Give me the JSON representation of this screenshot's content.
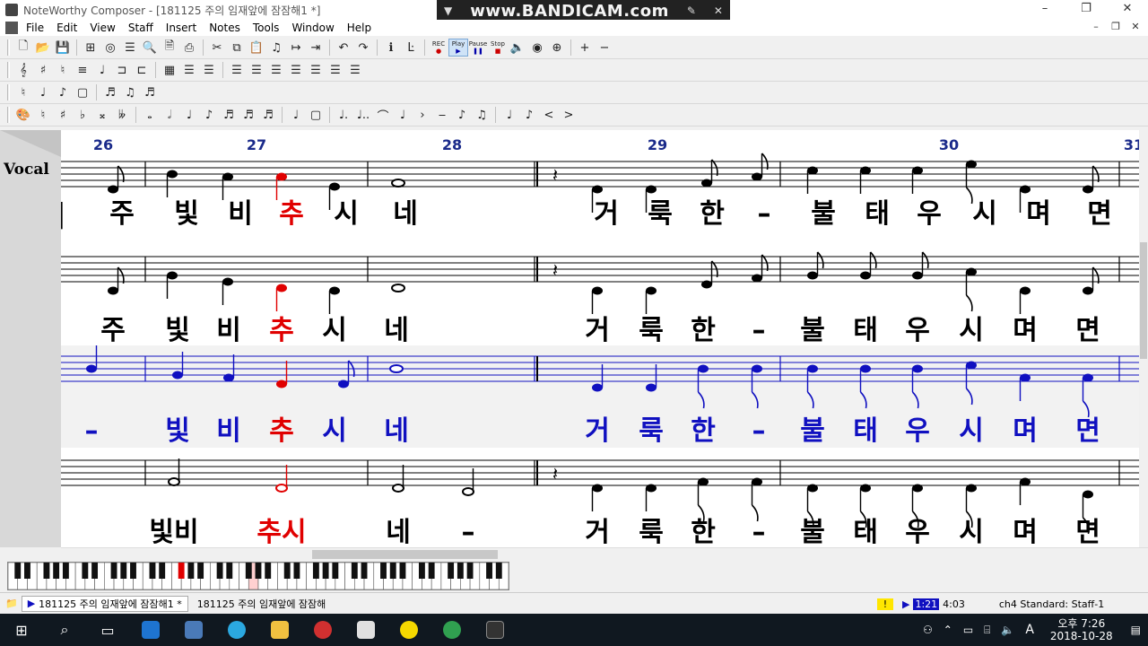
{
  "window": {
    "title": "NoteWorthy Composer - [181125 주의 임재앞에 잠잠해1 *]",
    "minimize": "–",
    "restore": "❐",
    "close": "✕"
  },
  "watermark": {
    "text": "www.BANDICAM.com"
  },
  "menu": {
    "items": [
      "File",
      "Edit",
      "View",
      "Staff",
      "Insert",
      "Notes",
      "Tools",
      "Window",
      "Help"
    ]
  },
  "toolbars": {
    "row1": [
      "new",
      "open",
      "save",
      "print",
      "cut",
      "copy",
      "paste",
      "undo",
      "redo",
      "rec",
      "play",
      "pause",
      "stop",
      "volume",
      "plus",
      "minus"
    ],
    "rec_label": "REC",
    "play_label": "Play",
    "pause_label": "Pause",
    "stop_label": "Stop"
  },
  "score": {
    "staff_name": "Vocal",
    "measure_numbers": [
      "26",
      "27",
      "28",
      "29",
      "30",
      "31"
    ],
    "lyrics": {
      "row1": [
        "|",
        "주",
        "빛",
        "비",
        "추",
        "시",
        "네",
        "거",
        "룩",
        "한",
        "–",
        "불",
        "태",
        "우",
        "시",
        "며",
        "면"
      ],
      "row2": [
        "주",
        "빛",
        "비",
        "추",
        "시",
        "네",
        "거",
        "룩",
        "한",
        "–",
        "불",
        "태",
        "우",
        "시",
        "며",
        "면"
      ],
      "row3": [
        "–",
        "빛",
        "비",
        "추",
        "시",
        "네",
        "거",
        "룩",
        "한",
        "–",
        "불",
        "태",
        "우",
        "시",
        "며",
        "면"
      ],
      "row4": [
        "빛비",
        "추시",
        "네",
        "–",
        "거",
        "룩",
        "한",
        "–",
        "불",
        "태",
        "우",
        "시",
        "며",
        "면"
      ]
    },
    "colors": {
      "measure_number": "#1a2a8a",
      "highlight": "#e00000",
      "active_staff": "#1010c0",
      "lyric": "#000000"
    }
  },
  "status": {
    "tab_active": "181125 주의 임재앞에 잠잠해1 *",
    "tab_other": "181125 주의 임재앞에 잠잠해",
    "indicator": "!",
    "position": "1:21",
    "time": "4:03",
    "channel": "ch4 Standard: Staff-1"
  },
  "taskbar": {
    "clock_time": "오후 7:26",
    "clock_date": "2018-10-28",
    "ime": "A"
  }
}
